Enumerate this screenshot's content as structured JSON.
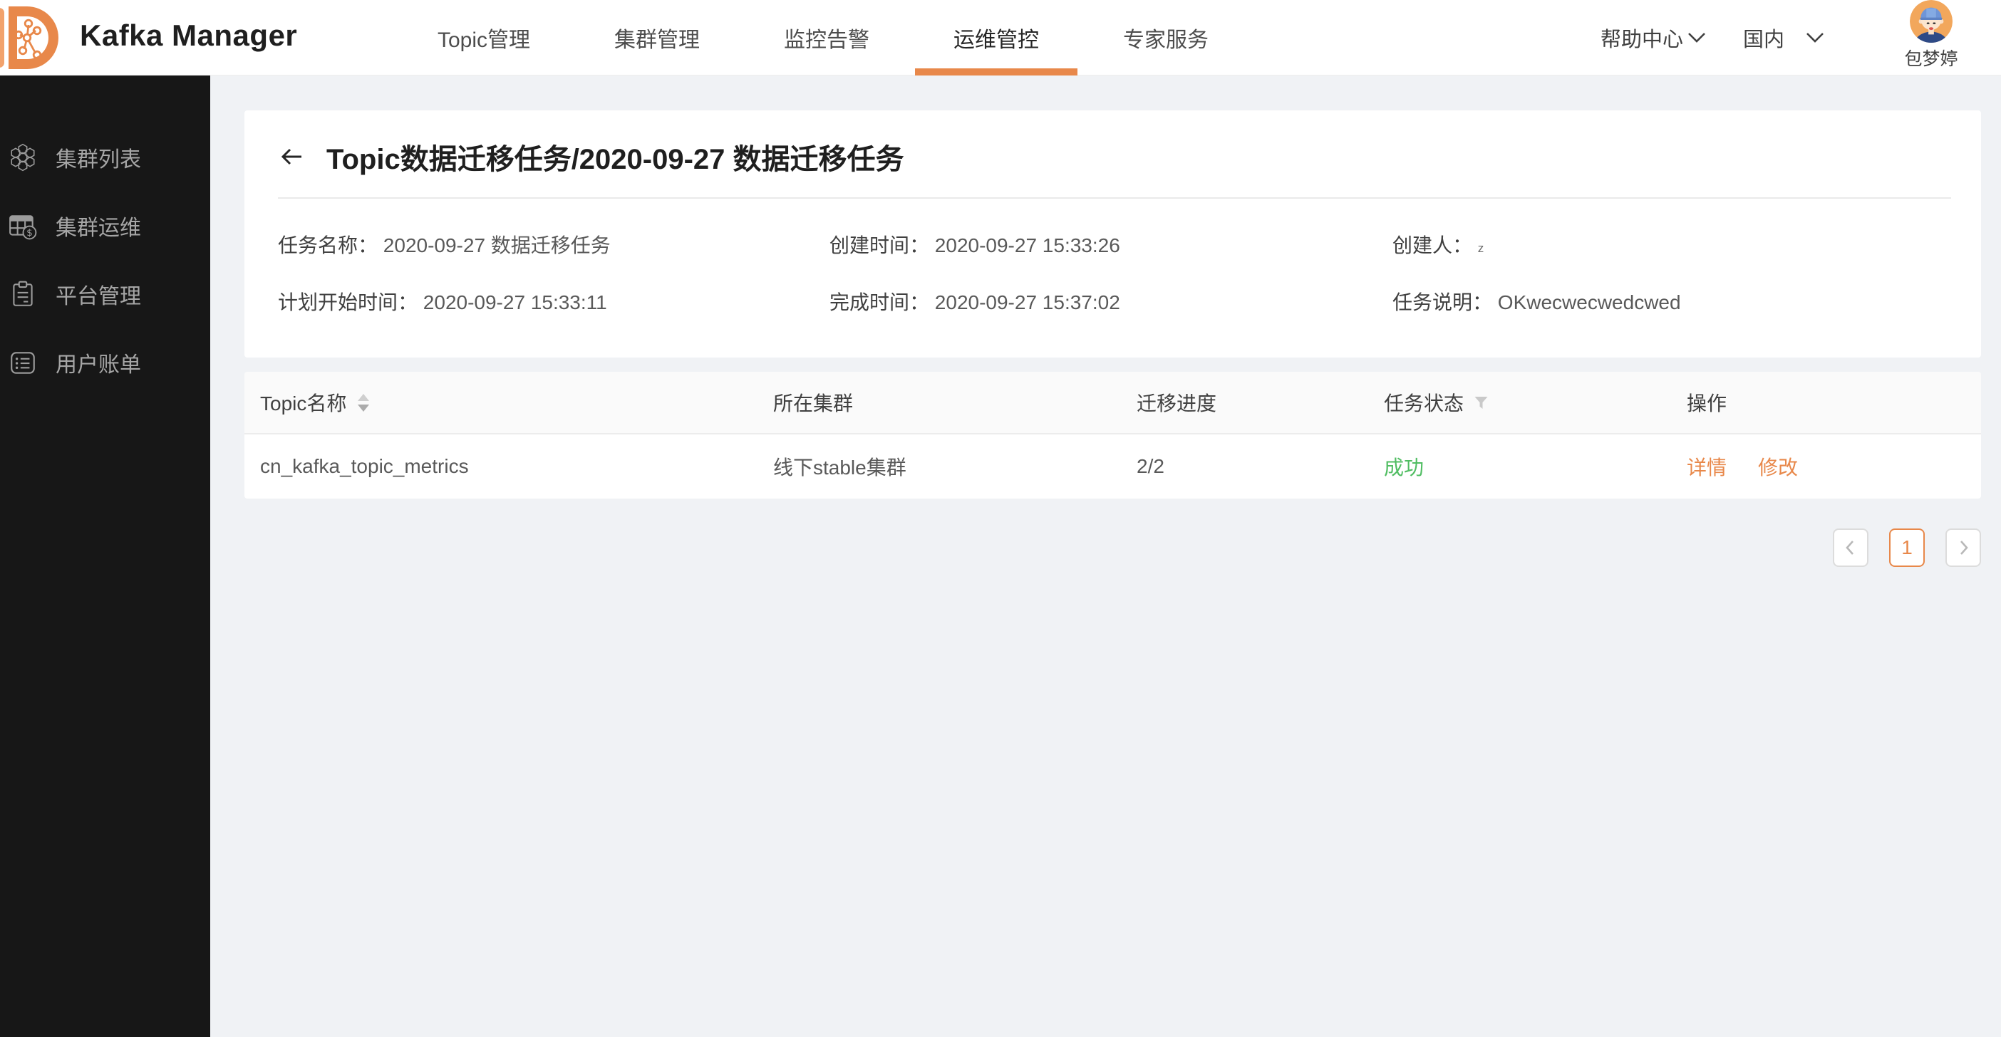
{
  "header": {
    "app_title": "Kafka Manager",
    "nav": [
      {
        "label": "Topic管理",
        "active": false
      },
      {
        "label": "集群管理",
        "active": false
      },
      {
        "label": "监控告警",
        "active": false
      },
      {
        "label": "运维管控",
        "active": true
      },
      {
        "label": "专家服务",
        "active": false
      }
    ],
    "help_center": "帮助中心",
    "region": "国内",
    "username": "包梦婷"
  },
  "sidebar": {
    "items": [
      {
        "label": "集群列表",
        "icon": "honeycomb-cluster-icon"
      },
      {
        "label": "集群运维",
        "icon": "table-coin-icon"
      },
      {
        "label": "平台管理",
        "icon": "clipboard-icon"
      },
      {
        "label": "用户账单",
        "icon": "billing-list-icon"
      }
    ]
  },
  "page": {
    "title": "Topic数据迁移任务/2020-09-27 数据迁移任务",
    "details": [
      {
        "label": "任务名称：",
        "value": "2020-09-27 数据迁移任务"
      },
      {
        "label": "创建时间：",
        "value": "2020-09-27 15:33:26"
      },
      {
        "label": "创建人：",
        "value": "z"
      },
      {
        "label": "计划开始时间：",
        "value": "2020-09-27 15:33:11"
      },
      {
        "label": "完成时间：",
        "value": "2020-09-27 15:37:02"
      },
      {
        "label": "任务说明：",
        "value": "OKwecwecwedcwed"
      }
    ]
  },
  "table": {
    "columns": [
      "Topic名称",
      "所在集群",
      "迁移进度",
      "任务状态",
      "操作"
    ],
    "rows": [
      {
        "topic": "cn_kafka_topic_metrics",
        "cluster": "线下stable集群",
        "progress": "2/2",
        "status": "成功",
        "action_detail": "详情",
        "action_edit": "修改"
      }
    ]
  },
  "pagination": {
    "current": "1"
  },
  "icons": {
    "sort": "caret-sorter-icon",
    "filter": "funnel-icon",
    "back": "arrow-left-icon",
    "dropdown": "chevron-down-icon"
  },
  "colors": {
    "accent": "#E8884A",
    "success": "#50BD62"
  }
}
